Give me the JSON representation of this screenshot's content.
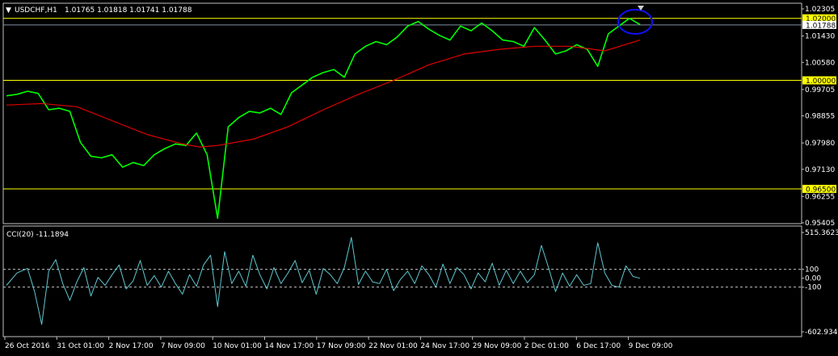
{
  "colors": {
    "background": "#000000",
    "frame": "#c0c0c0",
    "price": "#00ff00",
    "ma": "#e00000",
    "level": "#ffff00",
    "cci": "#5fc8d0",
    "circle": "#1010ff",
    "text": "#ffffff",
    "current_line": "#8090a0"
  },
  "header": {
    "arrow": "▼",
    "symbol": "USDCHF,H1",
    "ohlc": "1.01765 1.01818 1.01741 1.01788"
  },
  "cci_header": {
    "label": "CCI(20) -11.1894"
  },
  "chart_data": [
    {
      "type": "line",
      "pane": "price",
      "ylim": [
        0.95405,
        1.02305
      ],
      "yticks": [
        "1.02305",
        "1.01430",
        "1.00580",
        "0.99705",
        "0.98855",
        "0.97980",
        "0.97130",
        "0.96255",
        "0.95405"
      ],
      "levels": [
        {
          "value": 1.02,
          "label": "1.02000"
        },
        {
          "value": 1.0,
          "label": "1.00000"
        },
        {
          "value": 0.965,
          "label": "0.96500"
        }
      ],
      "current_price": {
        "value": 1.01788,
        "label": "1.01788"
      },
      "xticks": [
        "26 Oct 2016",
        "31 Oct 01:00",
        "2 Nov 17:00",
        "7 Nov 09:00",
        "10 Nov 01:00",
        "14 Nov 17:00",
        "17 Nov 09:00",
        "22 Nov 01:00",
        "24 Nov 17:00",
        "29 Nov 09:00",
        "2 Dec 01:00",
        "6 Dec 17:00",
        "9 Dec 09:00"
      ],
      "series": [
        {
          "role": "price",
          "x": [
            0,
            3,
            6,
            9,
            12,
            15,
            18,
            21,
            24,
            27,
            30,
            33,
            36,
            39,
            42,
            45,
            48,
            51,
            54,
            57,
            60,
            63,
            66,
            69,
            72,
            75,
            78,
            81,
            84,
            87,
            90,
            93,
            96,
            99,
            102,
            105,
            108,
            111,
            114,
            117,
            120,
            123,
            126,
            129,
            132,
            135,
            138,
            141,
            144,
            147,
            150,
            153,
            156,
            159,
            162,
            165,
            168,
            171,
            174,
            177,
            180
          ],
          "y": [
            0.995,
            0.9955,
            0.9965,
            0.9958,
            0.9905,
            0.991,
            0.99,
            0.98,
            0.9755,
            0.975,
            0.976,
            0.972,
            0.9735,
            0.9725,
            0.976,
            0.978,
            0.9795,
            0.979,
            0.983,
            0.976,
            0.9555,
            0.985,
            0.988,
            0.99,
            0.9895,
            0.991,
            0.989,
            0.996,
            0.9985,
            1.001,
            1.0025,
            1.0035,
            1.001,
            1.0085,
            1.011,
            1.0125,
            1.0115,
            1.014,
            1.0175,
            1.019,
            1.0165,
            1.0145,
            1.013,
            1.0175,
            1.016,
            1.0185,
            1.016,
            1.013,
            1.0125,
            1.011,
            1.017,
            1.013,
            1.0085,
            1.0095,
            1.0115,
            1.01,
            1.0045,
            1.015,
            1.0175,
            1.02,
            1.018
          ]
        },
        {
          "role": "ma",
          "x": [
            0,
            10,
            20,
            30,
            40,
            50,
            55,
            60,
            70,
            80,
            90,
            100,
            110,
            120,
            130,
            140,
            150,
            160,
            170,
            180
          ],
          "y": [
            0.992,
            0.9925,
            0.9915,
            0.987,
            0.9825,
            0.9795,
            0.9785,
            0.979,
            0.981,
            0.985,
            0.9905,
            0.9955,
            1.0,
            1.005,
            1.0085,
            1.01,
            1.011,
            1.011,
            1.0095,
            1.013
          ]
        }
      ]
    },
    {
      "type": "line",
      "pane": "cci",
      "ylim": [
        -602.9342,
        515.3623
      ],
      "yticks": [
        "515.3623",
        "100",
        "0.00",
        "-100",
        "-602.9342"
      ],
      "levels": [
        100,
        -100
      ],
      "series": [
        {
          "role": "cci",
          "x": [
            0,
            3,
            6,
            8,
            10,
            12,
            14,
            16,
            18,
            20,
            22,
            24,
            26,
            28,
            30,
            32,
            34,
            36,
            38,
            40,
            42,
            44,
            46,
            48,
            50,
            52,
            54,
            56,
            58,
            60,
            62,
            64,
            66,
            68,
            70,
            72,
            74,
            76,
            78,
            80,
            82,
            84,
            86,
            88,
            90,
            92,
            94,
            96,
            98,
            100,
            102,
            104,
            106,
            108,
            110,
            112,
            114,
            116,
            118,
            120,
            122,
            124,
            126,
            128,
            130,
            132,
            134,
            136,
            138,
            140,
            142,
            144,
            146,
            148,
            150,
            152,
            154,
            156,
            158,
            160,
            162,
            164,
            166,
            168,
            170,
            172,
            174,
            176,
            178,
            180
          ],
          "y": [
            -80,
            60,
            110,
            -150,
            -520,
            80,
            210,
            -60,
            -250,
            -40,
            120,
            -200,
            10,
            -80,
            40,
            150,
            -120,
            -30,
            200,
            -80,
            30,
            -100,
            80,
            -60,
            -180,
            40,
            -90,
            150,
            260,
            -320,
            300,
            -60,
            80,
            -90,
            260,
            40,
            -120,
            120,
            -60,
            60,
            200,
            -50,
            90,
            -180,
            110,
            40,
            -60,
            120,
            460,
            -70,
            80,
            -40,
            -60,
            100,
            -140,
            -10,
            80,
            -60,
            140,
            40,
            -100,
            160,
            -60,
            120,
            40,
            -120,
            60,
            -40,
            170,
            -80,
            90,
            -60,
            80,
            -50,
            40,
            370,
            120,
            -150,
            60,
            -90,
            40,
            -80,
            -60,
            400,
            60,
            -80,
            -100,
            140,
            20,
            0
          ]
        }
      ]
    }
  ]
}
